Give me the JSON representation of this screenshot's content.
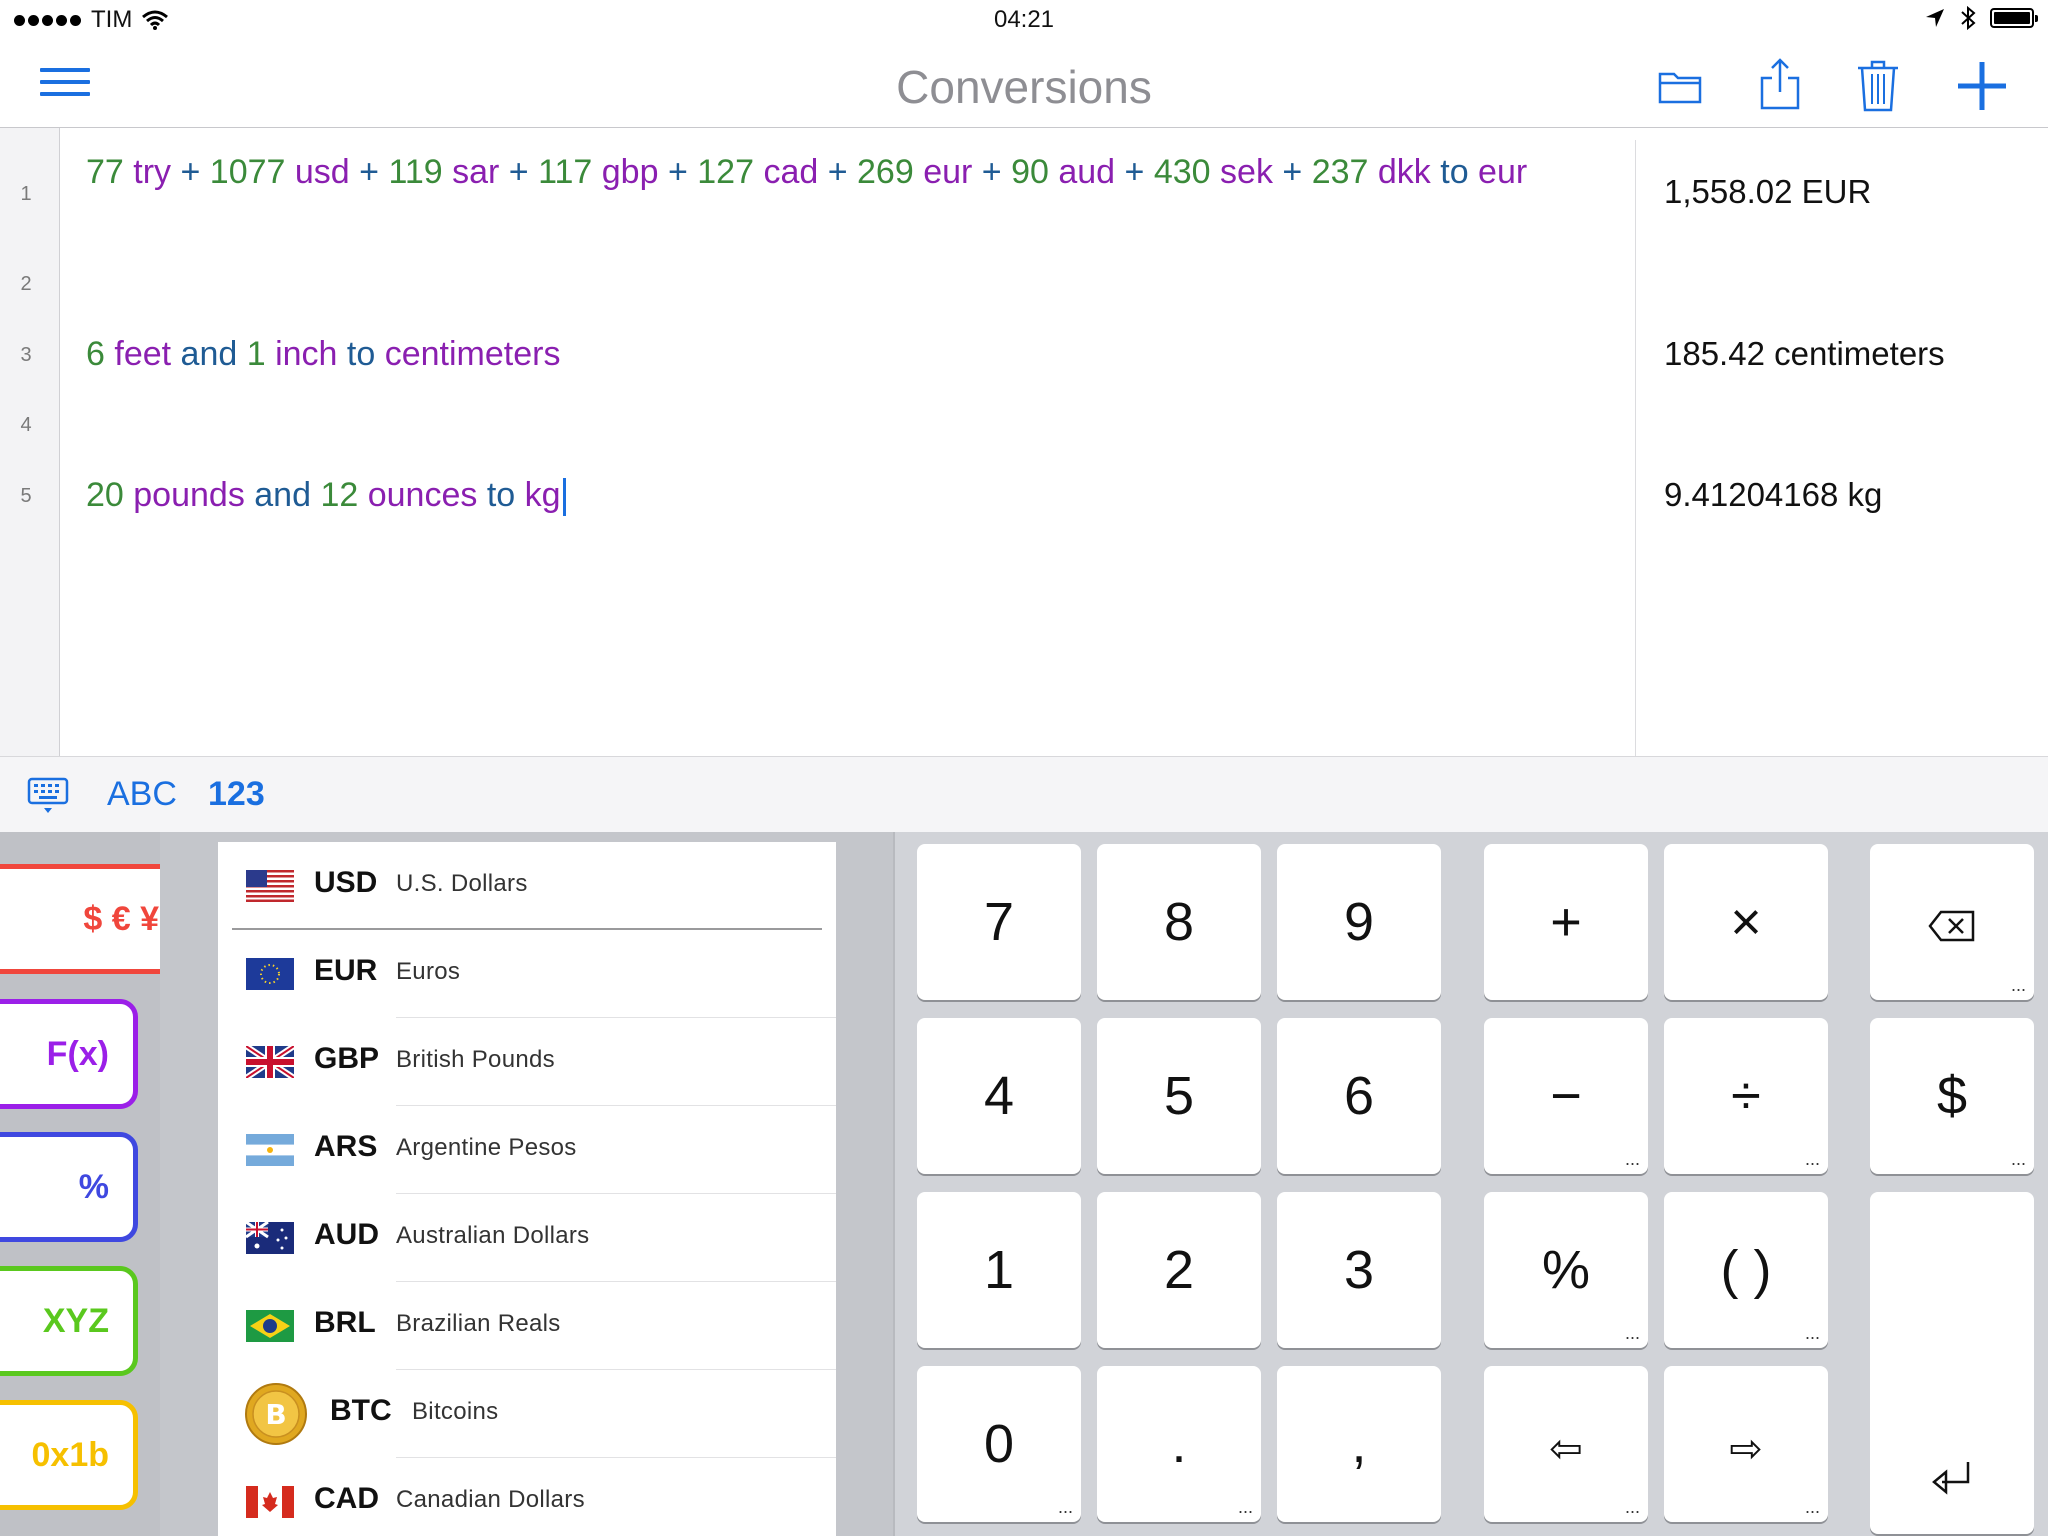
{
  "status": {
    "carrier": "TIM",
    "time": "04:21"
  },
  "navbar": {
    "title": "Conversions"
  },
  "editor": {
    "line_numbers": [
      "1",
      "2",
      "3",
      "4",
      "5"
    ],
    "line1": [
      {
        "t": "77",
        "c": "t-num"
      },
      {
        "t": " try",
        "c": "t-unit"
      },
      {
        "t": " +  ",
        "c": "t-kw"
      },
      {
        "t": "1077",
        "c": "t-num"
      },
      {
        "t": " usd",
        "c": "t-unit"
      },
      {
        "t": " +  ",
        "c": "t-kw"
      },
      {
        "t": "119",
        "c": "t-num"
      },
      {
        "t": " sar",
        "c": "t-unit"
      },
      {
        "t": " +  ",
        "c": "t-kw"
      },
      {
        "t": "117",
        "c": "t-num"
      },
      {
        "t": " gbp",
        "c": "t-unit"
      },
      {
        "t": " +  ",
        "c": "t-kw"
      },
      {
        "t": "127",
        "c": "t-num"
      },
      {
        "t": " cad",
        "c": "t-unit"
      },
      {
        "t": " +  ",
        "c": "t-kw"
      },
      {
        "t": "269",
        "c": "t-num"
      },
      {
        "t": " eur",
        "c": "t-unit"
      },
      {
        "t": " +  ",
        "c": "t-kw"
      },
      {
        "t": "90",
        "c": "t-num"
      },
      {
        "t": " aud",
        "c": "t-unit"
      },
      {
        "t": " +  ",
        "c": "t-kw"
      },
      {
        "t": "430",
        "c": "t-num"
      },
      {
        "t": " sek",
        "c": "t-unit"
      },
      {
        "t": " +  ",
        "c": "t-kw"
      },
      {
        "t": "237",
        "c": "t-num"
      },
      {
        "t": " dkk",
        "c": "t-unit"
      },
      {
        "t": " to ",
        "c": "t-kw"
      },
      {
        "t": "eur",
        "c": "t-unit"
      }
    ],
    "line3": [
      {
        "t": "6",
        "c": "t-num"
      },
      {
        "t": " feet",
        "c": "t-unit"
      },
      {
        "t": " and ",
        "c": "t-kw"
      },
      {
        "t": "1",
        "c": "t-num"
      },
      {
        "t": " inch",
        "c": "t-unit"
      },
      {
        "t": " to ",
        "c": "t-kw"
      },
      {
        "t": "centimeters",
        "c": "t-unit"
      }
    ],
    "line5": [
      {
        "t": "20",
        "c": "t-num"
      },
      {
        "t": " pounds",
        "c": "t-unit"
      },
      {
        "t": " and ",
        "c": "t-kw"
      },
      {
        "t": "12",
        "c": "t-num"
      },
      {
        "t": " ounces",
        "c": "t-unit"
      },
      {
        "t": " to ",
        "c": "t-kw"
      },
      {
        "t": "kg",
        "c": "t-unit"
      }
    ],
    "results": {
      "r1": "1,558.02 EUR",
      "r3": "185.42 centimeters",
      "r5": "9.41204168 kg"
    }
  },
  "modebar": {
    "abc": "ABC",
    "num": "123"
  },
  "categories": [
    {
      "name": "currency-category-button",
      "label": "$ € ¥",
      "color": "#f0463c"
    },
    {
      "name": "functions-category-button",
      "label": "F(x)",
      "color": "#9b1fe8"
    },
    {
      "name": "percent-category-button",
      "label": "%",
      "color": "#3f48e0"
    },
    {
      "name": "variables-category-button",
      "label": "XYZ",
      "color": "#5ac81e"
    },
    {
      "name": "hex-category-button",
      "label": "0x1b",
      "color": "#f6c000"
    }
  ],
  "currencies": [
    {
      "code": "USD",
      "name": "U.S. Dollars",
      "flag": "us-flag-icon"
    },
    {
      "code": "EUR",
      "name": "Euros",
      "flag": "eu-flag-icon"
    },
    {
      "code": "GBP",
      "name": "British Pounds",
      "flag": "uk-flag-icon"
    },
    {
      "code": "ARS",
      "name": "Argentine Pesos",
      "flag": "argentina-flag-icon"
    },
    {
      "code": "AUD",
      "name": "Australian Dollars",
      "flag": "australia-flag-icon"
    },
    {
      "code": "BRL",
      "name": "Brazilian Reals",
      "flag": "brazil-flag-icon"
    },
    {
      "code": "BTC",
      "name": "Bitcoins",
      "flag": "bitcoin-icon"
    },
    {
      "code": "CAD",
      "name": "Canadian Dollars",
      "flag": "canada-flag-icon"
    }
  ],
  "keys": {
    "k7": "7",
    "k8": "8",
    "k9": "9",
    "k4": "4",
    "k5": "5",
    "k6": "6",
    "k1": "1",
    "k2": "2",
    "k3": "3",
    "k0": "0",
    "dot": ".",
    "comma": ",",
    "plus": "+",
    "times": "×",
    "minus": "−",
    "divide": "÷",
    "percent": "%",
    "parens": "( )",
    "dollar": "$",
    "left": "⇦",
    "right": "⇨",
    "backspace": "⌫",
    "enter": "⏎",
    "more": "..."
  }
}
